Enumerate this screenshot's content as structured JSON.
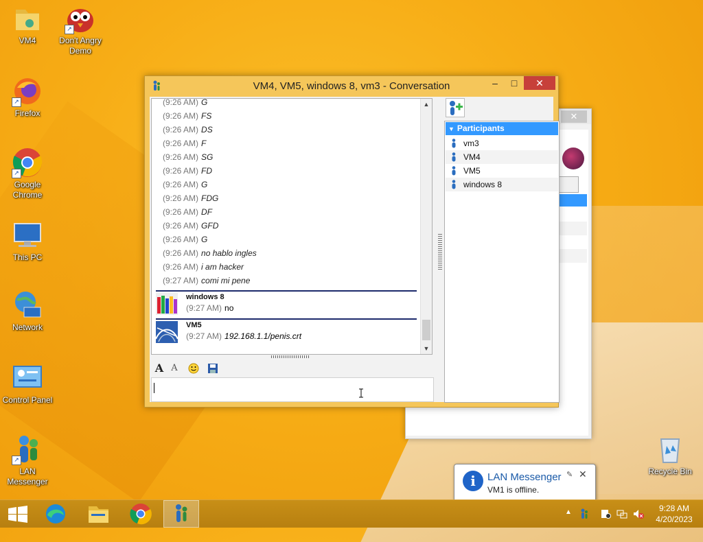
{
  "desktop": {
    "icons": [
      {
        "label": "VM4"
      },
      {
        "label": "Don't Angry Demo"
      },
      {
        "label": "Firefox"
      },
      {
        "label": "Google Chrome"
      },
      {
        "label": "This PC"
      },
      {
        "label": "Network"
      },
      {
        "label": "Control Panel"
      },
      {
        "label": "LAN Messenger"
      },
      {
        "label": "Recycle Bin"
      }
    ]
  },
  "conversation": {
    "title": "VM4, VM5, windows 8, vm3 - Conversation",
    "messages": [
      {
        "time": "(9:26 AM)",
        "text": "G"
      },
      {
        "time": "(9:26 AM)",
        "text": "FS"
      },
      {
        "time": "(9:26 AM)",
        "text": "DS"
      },
      {
        "time": "(9:26 AM)",
        "text": "F"
      },
      {
        "time": "(9:26 AM)",
        "text": "SG"
      },
      {
        "time": "(9:26 AM)",
        "text": "FD"
      },
      {
        "time": "(9:26 AM)",
        "text": "G"
      },
      {
        "time": "(9:26 AM)",
        "text": "FDG"
      },
      {
        "time": "(9:26 AM)",
        "text": "DF"
      },
      {
        "time": "(9:26 AM)",
        "text": "GFD"
      },
      {
        "time": "(9:26 AM)",
        "text": "G"
      },
      {
        "time": "(9:26 AM)",
        "text": "no hablo ingles"
      },
      {
        "time": "(9:26 AM)",
        "text": "i am hacker"
      },
      {
        "time": "(9:27 AM)",
        "text": "comi mi pene"
      }
    ],
    "senders": [
      {
        "name": "windows 8",
        "time": "(9:27 AM)",
        "text": "no"
      },
      {
        "name": "VM5",
        "time": "(9:27 AM)",
        "text": "192.168.1.1/penis.crt"
      }
    ],
    "input_value": "",
    "participants_header": "Participants",
    "participants": [
      "vm3",
      "VM4",
      "VM5",
      "windows 8"
    ]
  },
  "notification": {
    "title": "LAN Messenger",
    "body": "VM1 is offline."
  },
  "taskbar": {
    "time": "9:28 AM",
    "date": "4/20/2023"
  },
  "colors": {
    "accent": "#3399ff",
    "separator": "#1c2a6b",
    "close_button": "#c7403a",
    "window_frame": "#f5c65a"
  }
}
